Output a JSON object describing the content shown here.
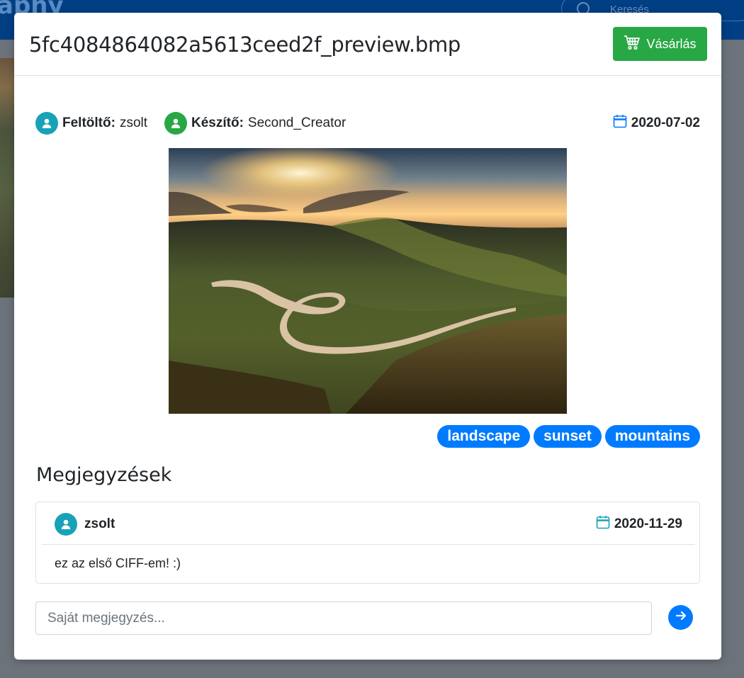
{
  "background": {
    "brand_fragment": "aphy",
    "search_placeholder": "Keresés"
  },
  "modal": {
    "title": "5fc4084864082a5613ceed2f_preview.bmp",
    "buy_label": "Vásárlás"
  },
  "meta": {
    "uploader_label": "Feltöltő:",
    "uploader_value": "zsolt",
    "creator_label": "Készítő:",
    "creator_value": "Second_Creator",
    "date": "2020-07-02"
  },
  "tags": [
    "landscape",
    "sunset",
    "mountains"
  ],
  "comments": {
    "title": "Megjegyzések",
    "items": [
      {
        "user": "zsolt",
        "date": "2020-11-29",
        "text": "ez az első CIFF-em! :)"
      }
    ],
    "input_placeholder": "Saját megjegyzés..."
  },
  "colors": {
    "buy_button": "#28a745",
    "tag": "#007bff",
    "uploader_avatar": "#17a2b8",
    "creator_avatar": "#28a745",
    "calendar_icon": "#007bff",
    "send_button": "#007bff",
    "navbar": "#003f84"
  },
  "icons": [
    "cart-icon",
    "user-icon",
    "calendar-icon",
    "arrow-right-icon",
    "search-icon"
  ]
}
